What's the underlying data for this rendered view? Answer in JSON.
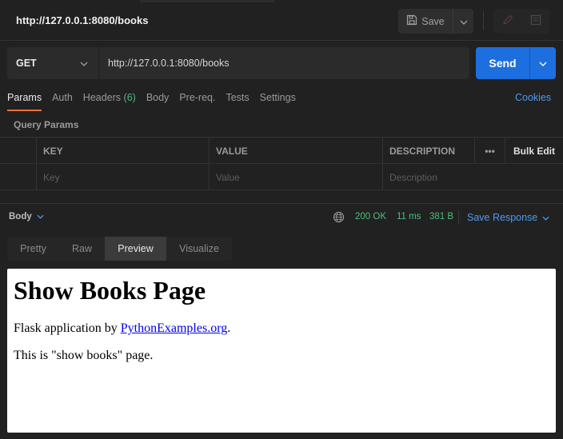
{
  "window": {
    "tab_title": "http://127.0.0.1:8080/books",
    "save_label": "Save"
  },
  "request": {
    "method": "GET",
    "url": "http://127.0.0.1:8080/books",
    "send_label": "Send"
  },
  "request_tabs": [
    {
      "label": "Params",
      "active": true
    },
    {
      "label": "Auth"
    },
    {
      "label": "Headers",
      "count": "(6)"
    },
    {
      "label": "Body"
    },
    {
      "label": "Pre-req."
    },
    {
      "label": "Tests"
    },
    {
      "label": "Settings"
    }
  ],
  "cookies_label": "Cookies",
  "query_params": {
    "title": "Query Params",
    "columns": {
      "key": "KEY",
      "value": "VALUE",
      "description": "DESCRIPTION"
    },
    "more_label": "•••",
    "bulk_edit_label": "Bulk Edit",
    "placeholders": {
      "key": "Key",
      "value": "Value",
      "description": "Description"
    }
  },
  "response": {
    "body_label": "Body",
    "status": "200 OK",
    "time": "11 ms",
    "size": "381 B",
    "save_response_label": "Save Response",
    "view_tabs": [
      "Pretty",
      "Raw",
      "Preview",
      "Visualize"
    ],
    "active_view": "Preview"
  },
  "preview_page": {
    "heading": "Show Books Page",
    "para1_prefix": "Flask application by ",
    "para1_link": "PythonExamples.org",
    "para1_suffix": ".",
    "para2": "This is \"show books\" page."
  },
  "colors": {
    "accent_blue": "#1d6fe0",
    "link_blue": "#4c9bf2",
    "status_green": "#4cbf7c",
    "active_tab_orange": "#ff6c37"
  },
  "icons": [
    "save-icon",
    "chevron-down-icon",
    "pencil-icon",
    "comment-icon",
    "globe-icon"
  ]
}
